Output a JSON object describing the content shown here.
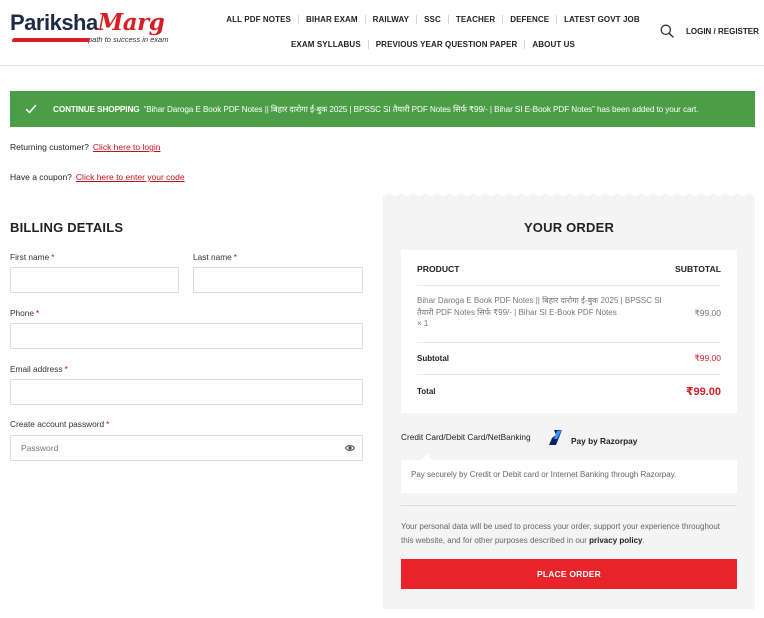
{
  "header": {
    "logo": {
      "part1": "Pariksha",
      "part2": "Marg",
      "tagline": "path to success in exam"
    },
    "nav_row1": [
      "ALL PDF NOTES",
      "BIHAR EXAM",
      "RAILWAY",
      "SSC",
      "TEACHER",
      "DEFENCE",
      "LATEST GOVT JOB"
    ],
    "nav_row2": [
      "EXAM SYLLABUS",
      "PREVIOUS YEAR QUESTION PAPER",
      "ABOUT US"
    ],
    "login": "LOGIN / REGISTER"
  },
  "notice": {
    "action": "CONTINUE SHOPPING",
    "message": "“Bihar Daroga E Book PDF Notes || बिहार दारोगा ई-बुक 2025 | BPSSC SI तैयारी PDF Notes सिर्फ ₹99/- | Bihar SI E-Book PDF Notes” has been added to your cart.",
    "color": "#4c9d47"
  },
  "returning": {
    "text": "Returning customer?",
    "link": "Click here to login"
  },
  "coupon": {
    "text": "Have a coupon?",
    "link": "Click here to enter your code"
  },
  "billing": {
    "title": "BILLING DETAILS",
    "first_name": "First name",
    "last_name": "Last name",
    "phone": "Phone",
    "email": "Email address",
    "password": "Create account password",
    "password_placeholder": "Password",
    "required_mark": "*"
  },
  "order": {
    "title": "YOUR ORDER",
    "col_product": "PRODUCT",
    "col_subtotal": "SUBTOTAL",
    "product_name": "Bihar Daroga E Book PDF Notes || बिहार दारोगा ई-बुक 2025 | BPSSC SI तैयारी PDF Notes सिर्फ ₹99/- | Bihar SI E-Book PDF Notes",
    "quantity": "× 1",
    "product_price": "₹99.00",
    "subtotal_label": "Subtotal",
    "subtotal_value": "₹99.00",
    "total_label": "Total",
    "total_value": "₹99.00"
  },
  "payment": {
    "method_label": "Credit Card/Debit Card/NetBanking",
    "razorpay_label": "Pay by Razorpay",
    "description": "Pay securely by Credit or Debit card or Internet Banking through Razorpay."
  },
  "privacy": {
    "text": "Your personal data will be used to process your order, support your experience throughout this website, and for other purposes described in our",
    "link": "privacy policy",
    "end": "."
  },
  "place_order": "PLACE ORDER",
  "colors": {
    "accent_red": "#d71f26",
    "button_red": "#e8232a",
    "success_green": "#4c9d47"
  }
}
